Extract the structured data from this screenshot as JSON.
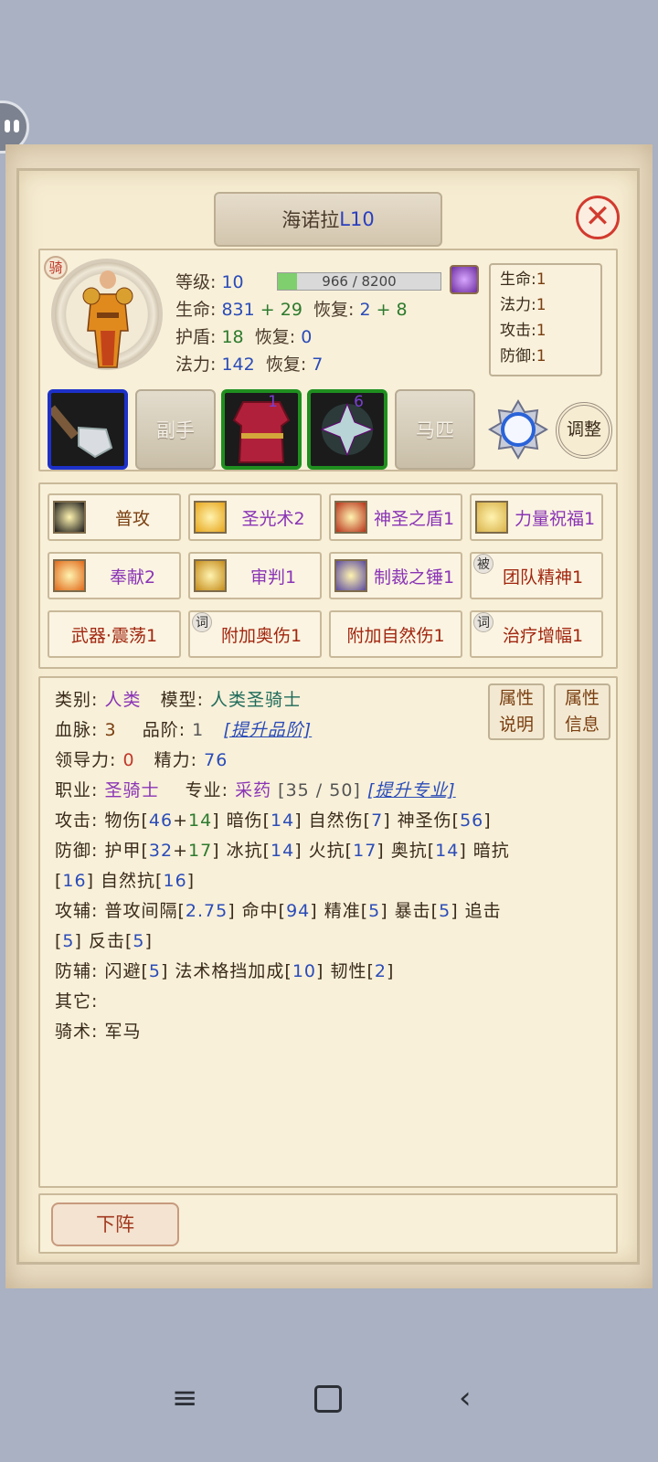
{
  "hero": {
    "name": "海诺拉",
    "level_tag": "L10",
    "mount_badge": "骑"
  },
  "stats": {
    "level_label": "等级:",
    "level_value": "10",
    "exp_text": "966 / 8200",
    "exp_fraction": 0.118,
    "hp_label": "生命:",
    "hp_value": "831",
    "hp_plus": "+ 29",
    "hp_regen_label": "恢复:",
    "hp_regen": "2",
    "hp_regen_plus": "+ 8",
    "shield_label": "护盾:",
    "shield_value": "18",
    "shield_regen_label": "恢复:",
    "shield_regen": "0",
    "mp_label": "法力:",
    "mp_value": "142",
    "mp_regen_label": "恢复:",
    "mp_regen": "7"
  },
  "bonus": [
    {
      "label": "生命:",
      "value": "1"
    },
    {
      "label": "法力:",
      "value": "1"
    },
    {
      "label": "攻击:",
      "value": "1"
    },
    {
      "label": "防御:",
      "value": "1"
    }
  ],
  "equipment": {
    "offhand_label": "副手",
    "armor_count": "1",
    "accessory_count": "6",
    "mount_label": "马匹",
    "adjust_label": "调整"
  },
  "skills": [
    {
      "label": "普攻",
      "color": "#7a3e10"
    },
    {
      "label": "圣光术2",
      "color": "#8a34b5"
    },
    {
      "label": "神圣之盾1",
      "color": "#8a34b5"
    },
    {
      "label": "力量祝福1",
      "color": "#8a34b5"
    },
    {
      "label": "奉献2",
      "color": "#8a34b5"
    },
    {
      "label": "审判1",
      "color": "#8a34b5"
    },
    {
      "label": "制裁之锤1",
      "color": "#8a34b5"
    },
    {
      "label": "团队精神1",
      "color": "#a1260f",
      "tag": "被"
    },
    {
      "label": "武器·震荡1",
      "color": "#a1260f"
    },
    {
      "label": "附加奥伤1",
      "color": "#a1260f",
      "tag": "词"
    },
    {
      "label": "附加自然伤1",
      "color": "#a1260f"
    },
    {
      "label": "治疗增幅1",
      "color": "#a1260f",
      "tag": "词"
    }
  ],
  "attributes": {
    "race_label": "类别:",
    "race": "人类",
    "model_label": "模型:",
    "model": "人类圣骑士",
    "bloodline_label": "血脉:",
    "bloodline": "3",
    "grade_label": "品阶:",
    "grade": "1",
    "upgrade_grade": "[提升品阶]",
    "leadership_label": "领导力:",
    "leadership": "0",
    "energy_label": "精力:",
    "energy": "76",
    "class_label": "职业:",
    "class": "圣骑士",
    "profession_label": "专业:",
    "profession": "采药",
    "profession_progress": "[35 / 50]",
    "upgrade_profession": "[提升专业]",
    "attack_label": "攻击:",
    "attack_parts": [
      "物伤[",
      "46",
      "+",
      "14",
      "] 暗伤[",
      "14",
      "] 自然伤[",
      "7",
      "] 神圣伤[",
      "56",
      "]"
    ],
    "defense_label": "防御:",
    "defense_line1": [
      "护甲[",
      "32",
      "+",
      "17",
      "] 冰抗[",
      "14",
      "] 火抗[",
      "17",
      "] 奥抗[",
      "14",
      "] 暗抗"
    ],
    "defense_line2": [
      "[",
      "16",
      "] 自然抗[",
      "16",
      "]"
    ],
    "offaux_label": "攻辅:",
    "offaux_line1": [
      "普攻间隔[",
      "2.75",
      "] 命中[",
      "94",
      "] 精准[",
      "5",
      "] 暴击[",
      "5",
      "] 追击"
    ],
    "offaux_line2": [
      "[",
      "5",
      "] 反击[",
      "5",
      "]"
    ],
    "defaux_label": "防辅:",
    "defaux_line": [
      "闪避[",
      "5",
      "] 法术格挡加成[",
      "10",
      "] 韧性[",
      "2",
      "]"
    ],
    "other_label": "其它:",
    "riding_label": "骑术:",
    "riding": "军马"
  },
  "buttons": {
    "attr_explain": [
      "属性",
      "说明"
    ],
    "attr_info": [
      "属性",
      "信息"
    ],
    "withdraw": "下阵"
  }
}
